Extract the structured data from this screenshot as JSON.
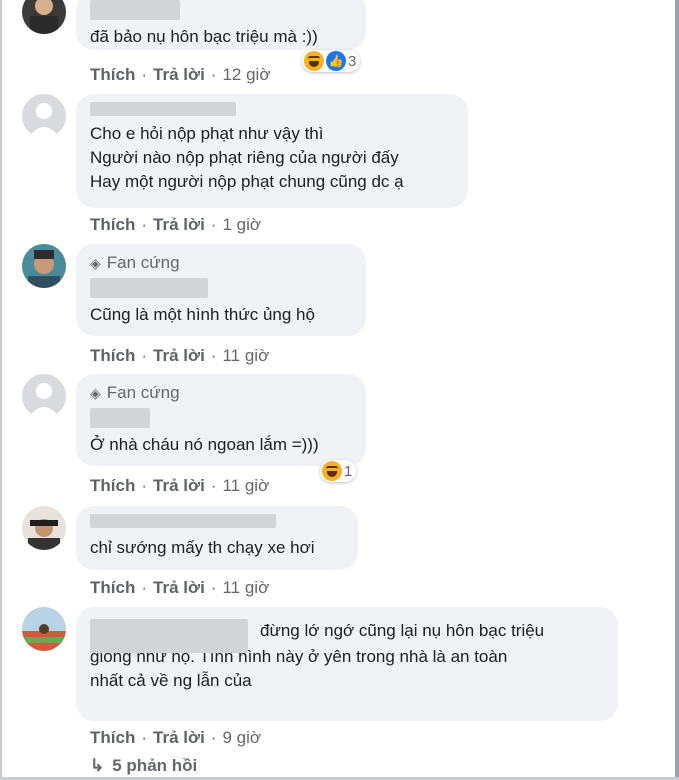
{
  "actions": {
    "like": "Thích",
    "reply": "Trả lời",
    "separator": "·"
  },
  "comments": [
    {
      "lines": [
        "đã bảo nụ hôn bạc triệu mà :))"
      ],
      "time": "12 giờ",
      "reaction_count": "3"
    },
    {
      "lines": [
        "Cho e hỏi nộp phạt như vậy thì",
        "Người nào nộp phạt riêng của người đấy",
        "Hay một người nộp phạt chung cũng dc ạ"
      ],
      "time": "1 giờ"
    },
    {
      "badge": "Fan cứng",
      "lines": [
        "Cũng là một hình thức ủng hộ"
      ],
      "time": "11 giờ"
    },
    {
      "badge": "Fan cứng",
      "lines": [
        "Ở nhà cháu nó ngoan lắm =)))"
      ],
      "time": "11 giờ",
      "reaction_count": "1"
    },
    {
      "lines": [
        "chỉ sướng mấy th chạy xe hơi"
      ],
      "time": "11 giờ"
    },
    {
      "lines": [
        "đừng lớ ngớ cũng lại nụ hôn bạc triệu",
        "giống như họ. Tình hình này ở yên trong nhà là an toàn",
        "nhất cả về ng lẫn của"
      ],
      "time": "9 giờ"
    }
  ],
  "replies_label": "5 phản hồi",
  "icons": {
    "reaction_haha": "haha-emoji-icon",
    "reaction_like": "like-thumb-icon",
    "badge": "diamond-icon",
    "reply_arrow": "reply-arrow-icon"
  },
  "colors": {
    "bubble": "#f0f2f5",
    "meta": "#65676b",
    "like_blue": "#1877f2",
    "haha_yellow": "#f7b125"
  }
}
